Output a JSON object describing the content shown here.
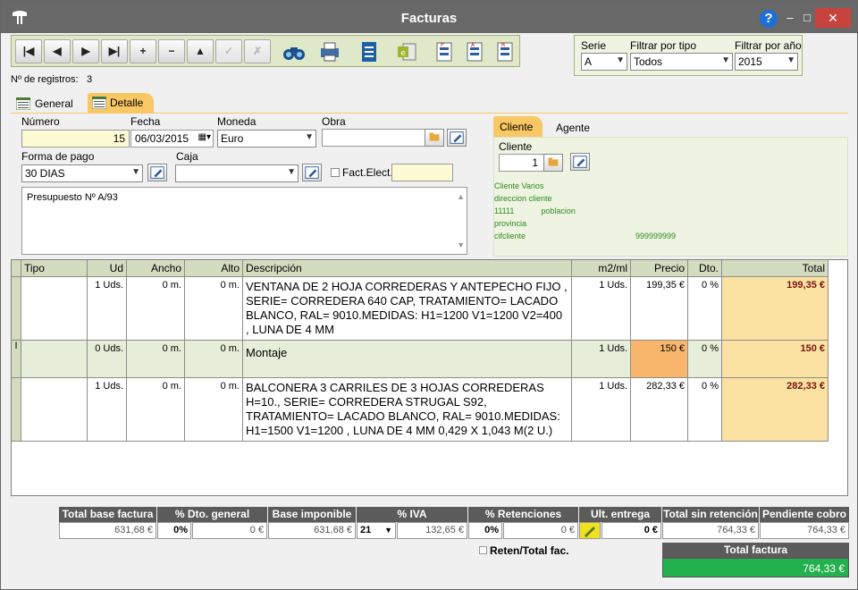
{
  "window": {
    "title": "Facturas",
    "help": "?",
    "minimize": "–",
    "maximize": "□",
    "close": "✕"
  },
  "toolbar": {
    "buttons": [
      "|◀",
      "◀",
      "▶",
      "▶|",
      "+",
      "−",
      "▲",
      "✓",
      "✗"
    ]
  },
  "filters": {
    "serie_label": "Serie",
    "serie_value": "A",
    "tipo_label": "Filtrar por tipo",
    "tipo_value": "Todos",
    "anio_label": "Filtrar por año",
    "anio_value": "2015"
  },
  "records": {
    "label": "Nº de registros:",
    "count": "3"
  },
  "tabs": {
    "general": "General",
    "detalle": "Detalle"
  },
  "form": {
    "numero_label": "Número",
    "numero_value": "15",
    "fecha_label": "Fecha",
    "fecha_value": "06/03/2015",
    "moneda_label": "Moneda",
    "moneda_value": "Euro",
    "obra_label": "Obra",
    "obra_value": "",
    "forma_pago_label": "Forma de pago",
    "forma_pago_value": "30 DIAS",
    "caja_label": "Caja",
    "caja_value": "",
    "fact_elect_label": "Fact.Elect.",
    "notes": "Presupuesto Nº A/93"
  },
  "client_panel": {
    "tab_cliente": "Cliente",
    "tab_agente": "Agente",
    "cliente_label": "Cliente",
    "cliente_value": "1",
    "name": "Cliente Varios",
    "address": "direccion cliente",
    "postal": "11111",
    "city": "poblacion",
    "province": "provincia",
    "cif": "cifcliente",
    "phone": "999999999"
  },
  "grid": {
    "headers": {
      "tipo": "Tipo",
      "ud": "Ud",
      "ancho": "Ancho",
      "alto": "Alto",
      "descripcion": "Descripción",
      "m2ml": "m2/ml",
      "precio": "Precio",
      "dto": "Dto.",
      "total": "Total"
    },
    "rows": [
      {
        "ud": "1 Uds.",
        "ancho": "0 m.",
        "alto": "0 m.",
        "descripcion": "VENTANA DE 2 HOJA CORREDERAS Y ANTEPECHO FIJO , SERIE= CORREDERA 640 CAP, TRATAMIENTO= LACADO BLANCO, RAL= 9010.MEDIDAS: H1=1200 V1=1200 V2=400 , LUNA DE 4 MM",
        "m2ml": "1 Uds.",
        "precio": "199,35 €",
        "dto": "0 %",
        "total": "199,35 €"
      },
      {
        "ud": "0 Uds.",
        "ancho": "0 m.",
        "alto": "0 m.",
        "descripcion": "Montaje",
        "m2ml": "1 Uds.",
        "precio": "150 €",
        "dto": "0 %",
        "total": "150 €"
      },
      {
        "ud": "1 Uds.",
        "ancho": "0 m.",
        "alto": "0 m.",
        "descripcion": "BALCONERA 3 CARRILES DE 3 HOJAS CORREDERAS H=10., SERIE= CORREDERA STRUGAL S92, TRATAMIENTO= LACADO BLANCO, RAL= 9010.MEDIDAS: H1=1500 V1=1200 , LUNA DE 4 MM 0,429 X 1,043 M(2 U.)",
        "m2ml": "1 Uds.",
        "precio": "282,33 €",
        "dto": "0 %",
        "total": "282,33 €"
      }
    ]
  },
  "totals": {
    "base_factura_label": "Total base factura",
    "base_factura_value": "631,68 €",
    "dto_general_label": "% Dto. general",
    "dto_pct_value": "0%",
    "dto_amount_value": "0 €",
    "base_imponible_label": "Base imponible",
    "base_imponible_value": "631,68 €",
    "iva_label": "% IVA",
    "iva_pct_value": "21",
    "iva_amount_value": "132,65 €",
    "retenciones_label": "% Retenciones",
    "ret_pct_value": "0%",
    "ret_amount_value": "0 €",
    "ult_entrega_label": "Ult. entrega",
    "ult_entrega_value": "0 €",
    "sin_retencion_label": "Total sin retención",
    "sin_retencion_value": "764,33 €",
    "pendiente_label": "Pendiente cobro",
    "pendiente_value": "764,33 €",
    "reten_label": "Reten/Total fac.",
    "total_factura_label": "Total factura",
    "total_factura_value": "764,33 €"
  }
}
